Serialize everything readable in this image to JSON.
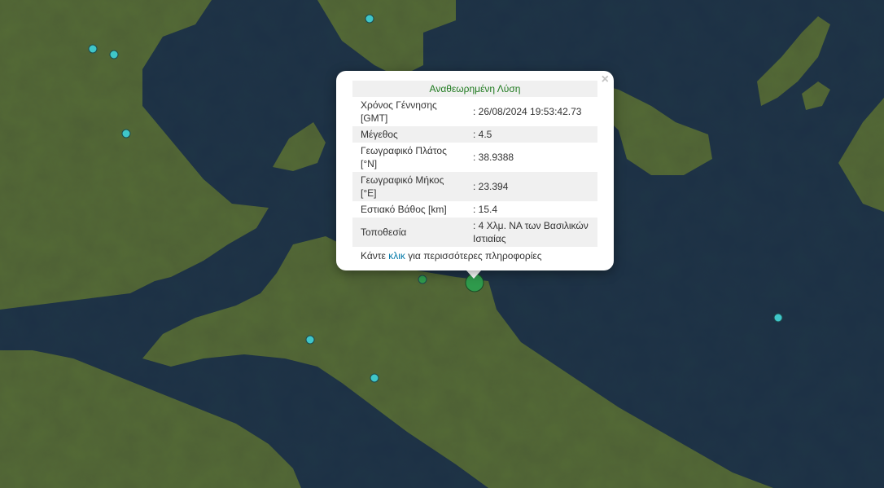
{
  "popup": {
    "title": "Αναθεωρημένη Λύση",
    "close_symbol": "×",
    "rows": [
      {
        "label": "Χρόνος Γέννησης [GMT]",
        "value": ": 26/08/2024 19:53:42.73"
      },
      {
        "label": "Μέγεθος",
        "value": ": 4.5"
      },
      {
        "label": "Γεωγραφικό Πλάτος [°N]",
        "value": ": 38.9388"
      },
      {
        "label": "Γεωγραφικό Μήκος [°E]",
        "value": ": 23.394"
      },
      {
        "label": "Εστιακό Βάθος [km]",
        "value": ": 15.4"
      },
      {
        "label": "Τοποθεσία",
        "value": ": 4 Χλμ. ΝΑ των Βασιλικών Ιστιαίας"
      }
    ],
    "more_prefix": "Κάντε",
    "more_link": "κλικ",
    "more_suffix": "για περισσότερες πληροφορίες"
  },
  "colors": {
    "sea": "#1c2f45",
    "land": "#4d5f35",
    "marker": "#3fc6c9",
    "selected_marker": "#2f9a4c"
  }
}
